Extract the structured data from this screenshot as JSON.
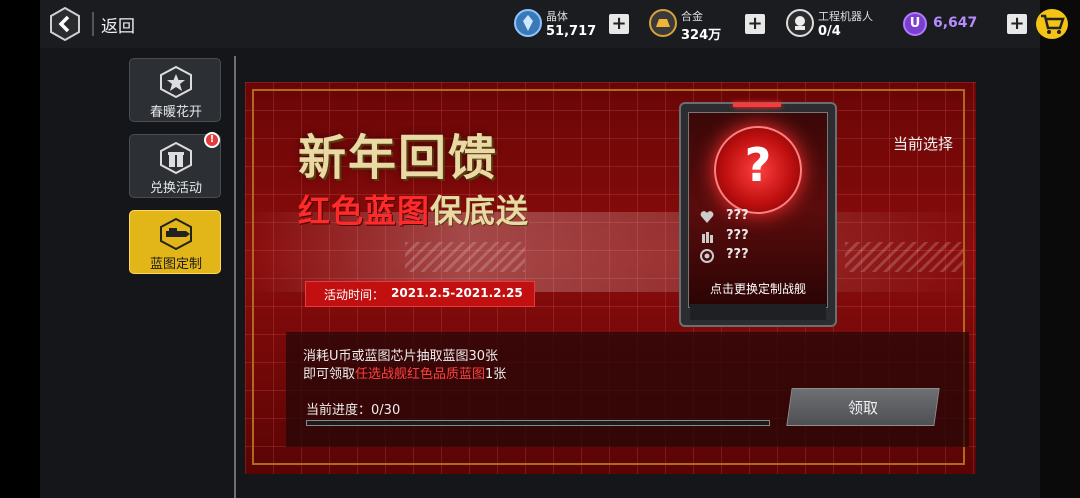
{
  "header": {
    "back_label": "返回",
    "resources": [
      {
        "name": "晶体",
        "value": "51,717",
        "icon": "crystal-icon"
      },
      {
        "name": "合金",
        "value": "324万",
        "icon": "alloy-icon"
      },
      {
        "name": "工程机器人",
        "value": "0/4",
        "icon": "robot-icon"
      }
    ],
    "currency": {
      "symbol": "U",
      "value": "6,647",
      "color": "#b58cff"
    }
  },
  "sidebar": {
    "items": [
      {
        "label": "春暖花开",
        "icon": "star-hexagon-icon",
        "active": false
      },
      {
        "label": "兑换活动",
        "icon": "gift-icon",
        "active": false,
        "badge": "!"
      },
      {
        "label": "蓝图定制",
        "icon": "blueprint-ship-icon",
        "active": true
      }
    ]
  },
  "event": {
    "title": "新年回馈",
    "subtitle_red": "红色蓝图",
    "subtitle_cream": "保底送",
    "time_label": "活动时间：",
    "time_value": "2021.2.5-2021.2.25",
    "current_choice": "当前选择",
    "card": {
      "symbol": "?",
      "stats": [
        "???",
        "???",
        "???"
      ],
      "caption": "点击更换定制战舰"
    },
    "desc_line1": "消耗U币或蓝图芯片抽取蓝图30张",
    "desc_line2_a": "即可领取",
    "desc_line2_hl": "任选战舰红色品质蓝图",
    "desc_line2_b": "1张",
    "progress_label": "当前进度：",
    "progress_value": "0/30",
    "progress_fraction": 0,
    "claim_label": "领取"
  },
  "colors": {
    "accent_gold": "#e2b519",
    "event_red": "#c21010",
    "highlight_red": "#ff4040"
  }
}
